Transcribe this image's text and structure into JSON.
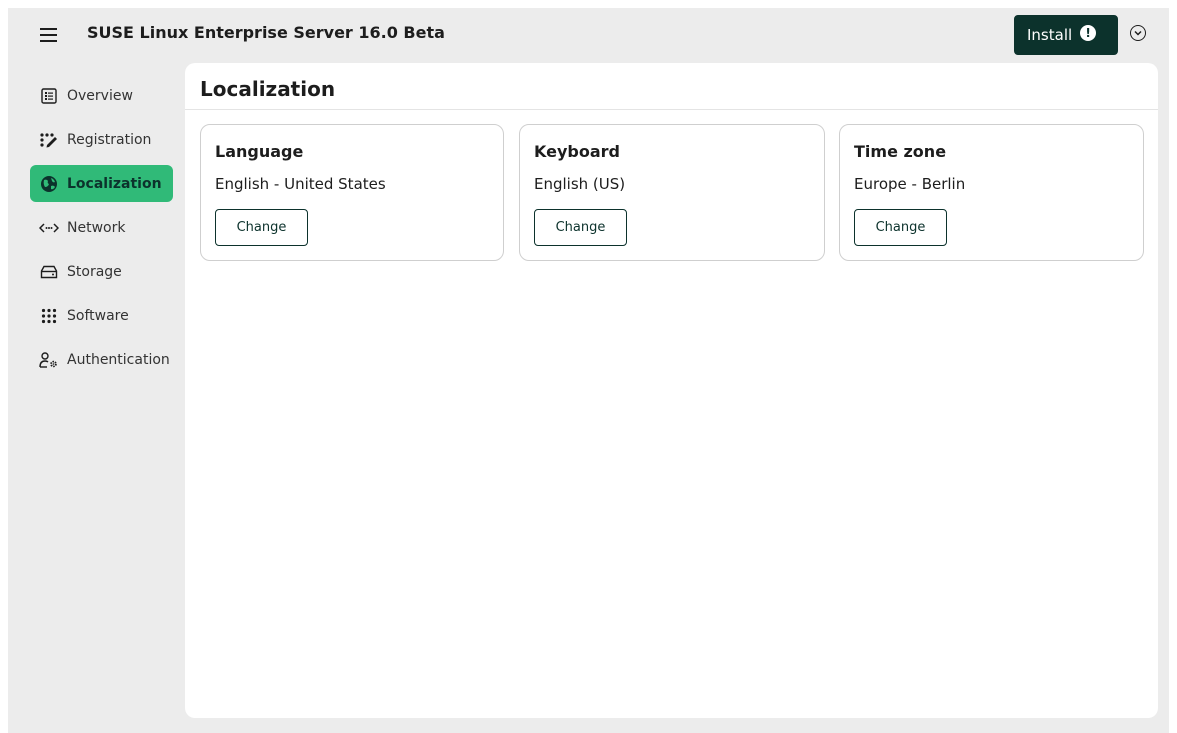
{
  "app": {
    "title": "SUSE Linux Enterprise Server 16.0 Beta",
    "install_label": "Install",
    "install_alert": "!",
    "icons": {
      "menu": "hamburger-menu-icon",
      "options": "chevron-down-circle-icon"
    },
    "colors": {
      "accent": "#30ba78",
      "primary_dark": "#0c322c",
      "background": "#ececec"
    }
  },
  "sidebar": {
    "items": [
      {
        "label": "Overview",
        "icon": "list-icon",
        "active": false
      },
      {
        "label": "Registration",
        "icon": "registration-icon",
        "active": false
      },
      {
        "label": "Localization",
        "icon": "globe-icon",
        "active": true
      },
      {
        "label": "Network",
        "icon": "network-icon",
        "active": false
      },
      {
        "label": "Storage",
        "icon": "storage-icon",
        "active": false
      },
      {
        "label": "Software",
        "icon": "grid-dots-icon",
        "active": false
      },
      {
        "label": "Authentication",
        "icon": "user-gear-icon",
        "active": false
      }
    ]
  },
  "main": {
    "title": "Localization",
    "cards": [
      {
        "title": "Language",
        "value": "English - United States",
        "button": "Change"
      },
      {
        "title": "Keyboard",
        "value": "English (US)",
        "button": "Change"
      },
      {
        "title": "Time zone",
        "value": "Europe - Berlin",
        "button": "Change"
      }
    ]
  }
}
